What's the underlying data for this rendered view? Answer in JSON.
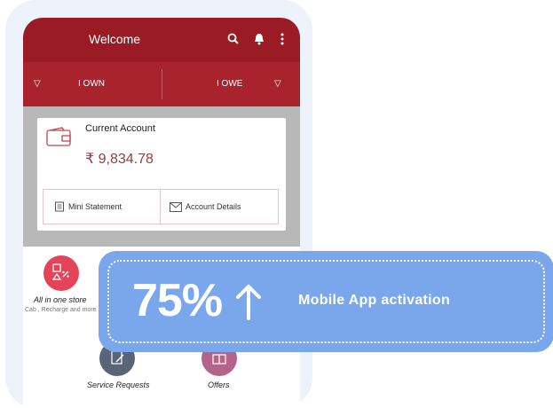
{
  "appbar": {
    "title": "Welcome",
    "icons": [
      "search-icon",
      "notification-icon",
      "more-icon"
    ]
  },
  "tabs": {
    "own": "I OWN",
    "owe": "I OWE"
  },
  "account_card": {
    "name": "Current Account",
    "balance": "₹ 9,834.78",
    "mini_statement": "Mini Statement",
    "account_details": "Account Details"
  },
  "tiles": [
    {
      "label": "All in one store",
      "sub": "Cab , Recharge and more",
      "color": "#e5435a"
    },
    {
      "label": "Service Requests",
      "color": "#5a6479"
    },
    {
      "label": "Offers",
      "color": "#b56489"
    }
  ],
  "banner": {
    "percent": "75%",
    "text": "Mobile App activation",
    "color": "#7aa7ec"
  },
  "colors": {
    "brand": "#9b1b24",
    "balance": "#9b3a3d"
  }
}
